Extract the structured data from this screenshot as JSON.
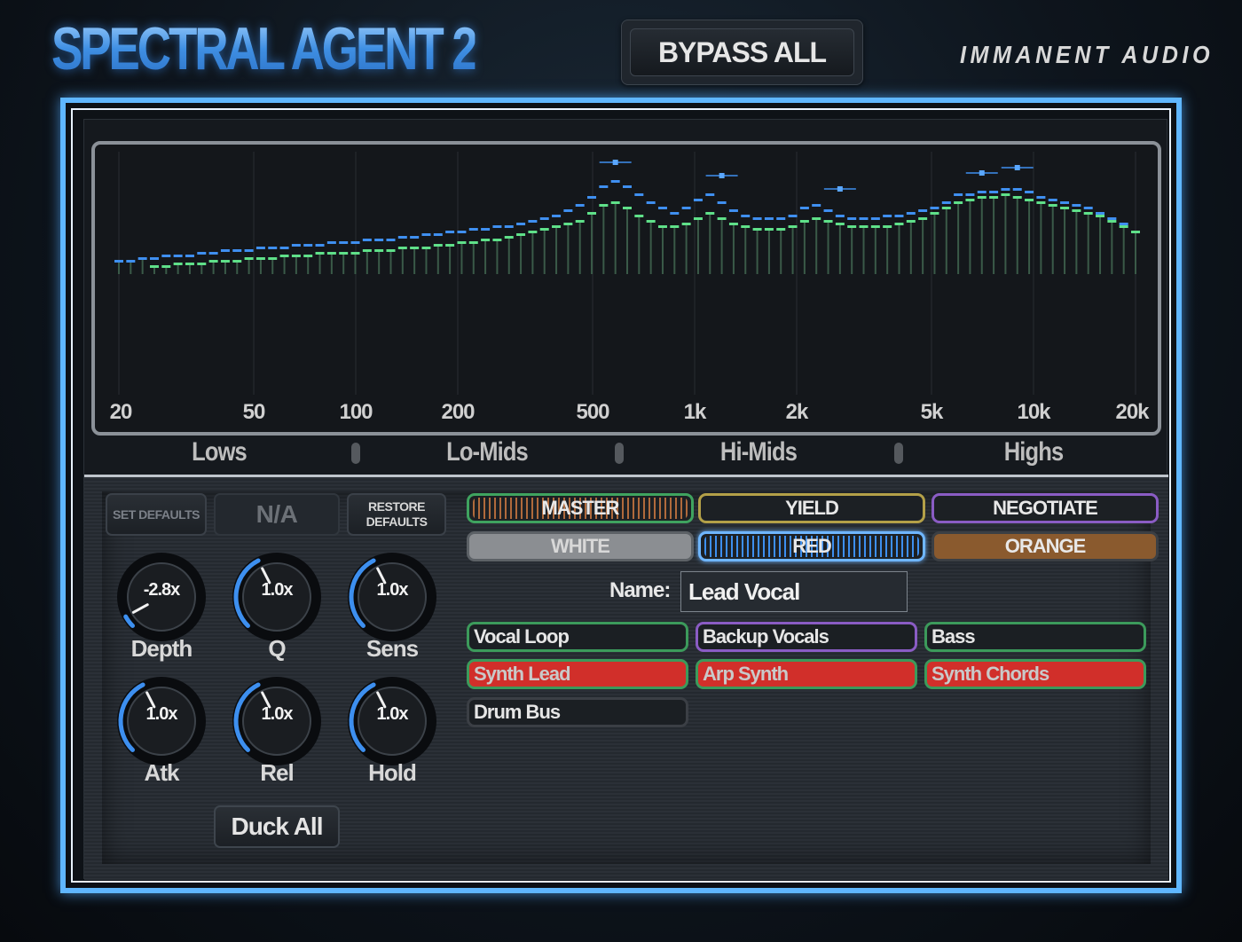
{
  "header": {
    "title": "SPECTRAL AGENT 2",
    "bypass_label": "BYPASS ALL",
    "brand": "IMMANENT AUDIO"
  },
  "spectrum": {
    "freq_labels": [
      "20",
      "50",
      "100",
      "200",
      "500",
      "1k",
      "2k",
      "5k",
      "10k",
      "20k"
    ],
    "band_labels": [
      "Lows",
      "Lo-Mids",
      "Hi-Mids",
      "Highs"
    ],
    "colors": {
      "series_a": "#3f8ff0",
      "series_b": "#5fe089",
      "stems": "#3a5a48"
    },
    "series_a_levels": [
      0.05,
      0.05,
      0.06,
      0.06,
      0.07,
      0.07,
      0.07,
      0.08,
      0.08,
      0.09,
      0.09,
      0.09,
      0.1,
      0.1,
      0.1,
      0.11,
      0.11,
      0.11,
      0.12,
      0.12,
      0.12,
      0.13,
      0.13,
      0.13,
      0.14,
      0.14,
      0.15,
      0.15,
      0.16,
      0.16,
      0.17,
      0.17,
      0.18,
      0.18,
      0.19,
      0.2,
      0.21,
      0.22,
      0.24,
      0.26,
      0.29,
      0.33,
      0.35,
      0.33,
      0.3,
      0.27,
      0.25,
      0.23,
      0.25,
      0.28,
      0.3,
      0.27,
      0.24,
      0.22,
      0.21,
      0.21,
      0.21,
      0.22,
      0.25,
      0.26,
      0.24,
      0.22,
      0.21,
      0.21,
      0.21,
      0.22,
      0.22,
      0.23,
      0.24,
      0.25,
      0.27,
      0.3,
      0.3,
      0.31,
      0.31,
      0.32,
      0.32,
      0.31,
      0.29,
      0.28,
      0.27,
      0.26,
      0.25,
      0.23,
      0.21,
      0.19,
      0.16
    ],
    "series_b_levels": [
      null,
      null,
      null,
      0.03,
      0.03,
      0.04,
      0.04,
      0.04,
      0.05,
      0.05,
      0.05,
      0.06,
      0.06,
      0.06,
      0.07,
      0.07,
      0.07,
      0.08,
      0.08,
      0.08,
      0.08,
      0.09,
      0.09,
      0.09,
      0.1,
      0.1,
      0.1,
      0.11,
      0.11,
      0.12,
      0.12,
      0.13,
      0.13,
      0.14,
      0.15,
      0.16,
      0.17,
      0.18,
      0.19,
      0.2,
      0.23,
      0.26,
      0.27,
      0.25,
      0.22,
      0.2,
      0.18,
      0.18,
      0.19,
      0.21,
      0.23,
      0.21,
      0.19,
      0.18,
      0.17,
      0.17,
      0.17,
      0.18,
      0.2,
      0.21,
      0.2,
      0.19,
      0.18,
      0.18,
      0.18,
      0.18,
      0.19,
      0.2,
      0.21,
      0.23,
      0.25,
      0.27,
      0.28,
      0.29,
      0.29,
      0.3,
      0.29,
      0.28,
      0.27,
      0.26,
      0.25,
      0.24,
      0.23,
      0.22,
      0.2,
      0.18,
      0.16
    ],
    "peak_markers": [
      0.42,
      0.37,
      0.32,
      0.38,
      0.4
    ]
  },
  "controls": {
    "set_defaults": "SET DEFAULTS",
    "preset": "N/A",
    "restore_defaults_line1": "RESTORE",
    "restore_defaults_line2": "DEFAULTS",
    "knobs": [
      {
        "label": "Depth",
        "value": "-2.8x",
        "position": 0.06
      },
      {
        "label": "Q",
        "value": "1.0x",
        "position": 0.4
      },
      {
        "label": "Sens",
        "value": "1.0x",
        "position": 0.4
      },
      {
        "label": "Atk",
        "value": "1.0x",
        "position": 0.4
      },
      {
        "label": "Rel",
        "value": "1.0x",
        "position": 0.4
      },
      {
        "label": "Hold",
        "value": "1.0x",
        "position": 0.4
      }
    ],
    "duck_all": "Duck All",
    "knob_colors": {
      "arc": "#3d8fef",
      "track": "#0a0c0f"
    }
  },
  "roles": {
    "row1": [
      {
        "label": "MASTER",
        "border": "#3fa35f",
        "fill": "#1c2024",
        "stripes": "#b06a3c"
      },
      {
        "label": "YIELD",
        "border": "#b3a048",
        "fill": "#1c2024"
      },
      {
        "label": "NEGOTIATE",
        "border": "#8a5cc4",
        "fill": "#1c2024"
      }
    ],
    "row2": [
      {
        "label": "WHITE",
        "border": "#5c6166",
        "fill": "#8b8e92"
      },
      {
        "label": "RED",
        "border": "#6fb6ff",
        "fill": "#1c2024",
        "stripes": "#3d8fef",
        "selected": true
      },
      {
        "label": "ORANGE",
        "border": "#3b3f44",
        "fill": "#8a5a2e"
      }
    ]
  },
  "name_field": {
    "label": "Name:",
    "value": "Lead Vocal"
  },
  "tracks": [
    {
      "label": "Vocal Loop",
      "border": "#3c9a5b",
      "fill": "#1b1f23",
      "text": "#e6e6e6"
    },
    {
      "label": "Backup Vocals",
      "border": "#8a5cc4",
      "fill": "#1b1f23",
      "text": "#e6e6e6"
    },
    {
      "label": "Bass",
      "border": "#3c9a5b",
      "fill": "#1b1f23",
      "text": "#e6e6e6"
    },
    {
      "label": "Synth Lead",
      "border": "#3c9a5b",
      "fill": "#d12f2a",
      "text": "#c9c9c9"
    },
    {
      "label": "Arp Synth",
      "border": "#3c9a5b",
      "fill": "#d12f2a",
      "text": "#c9c9c9"
    },
    {
      "label": "Synth Chords",
      "border": "#3c9a5b",
      "fill": "#d12f2a",
      "text": "#c9c9c9"
    },
    {
      "label": "Drum Bus",
      "border": "#3b3f45",
      "fill": "#1b1f23",
      "text": "#e6e6e6"
    }
  ]
}
